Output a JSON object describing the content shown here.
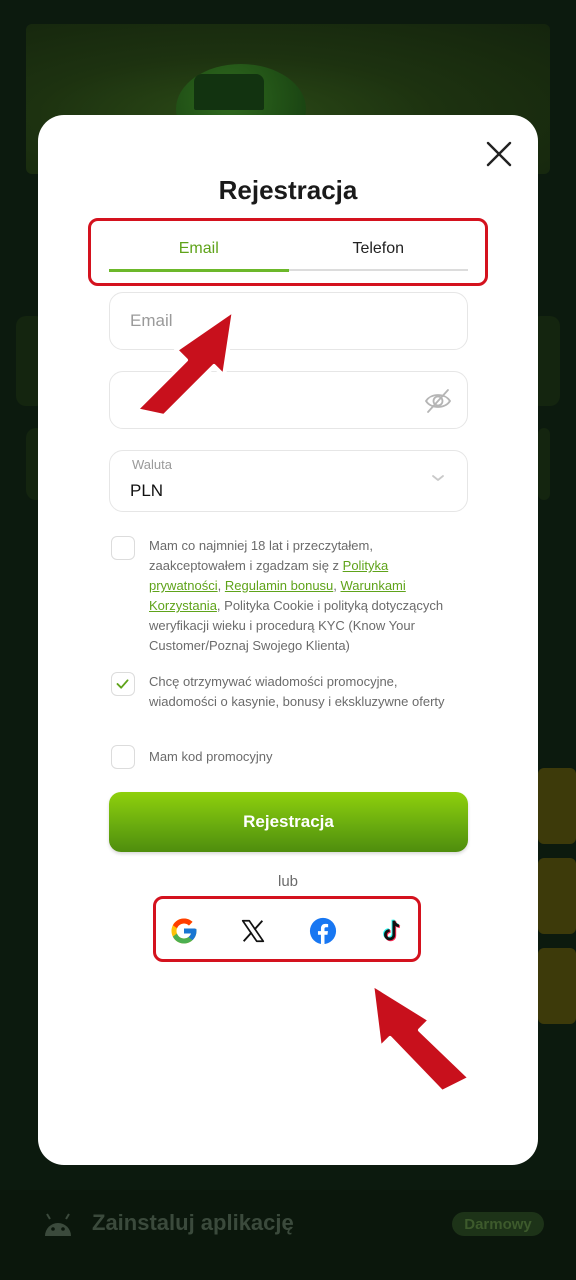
{
  "modal": {
    "title": "Rejestracja",
    "close_icon": "close-icon"
  },
  "tabs": [
    {
      "label": "Email",
      "active": true
    },
    {
      "label": "Telefon",
      "active": false
    }
  ],
  "form": {
    "email_placeholder": "Email",
    "password_placeholder": "",
    "currency_label": "Waluta",
    "currency_value": "PLN"
  },
  "consents": {
    "terms": {
      "checked": false,
      "text_part1": "Mam co najmniej 18 lat i przeczytałem, zaakceptowałem i zgadzam się z ",
      "link1": "Polityka prywatności",
      "sep1": ", ",
      "link2": "Regulamin bonusu",
      "sep2": ", ",
      "link3": "Warunkami Korzystania",
      "text_part2": ", Polityka Cookie i polityką dotyczących weryfikacji wieku i procedurą KYC (Know Your Customer/Poznaj Swojego Klienta)"
    },
    "marketing": {
      "checked": true,
      "text": "Chcę otrzymywać wiadomości promocyjne, wiadomości o kasynie, bonusy i ekskluzywne oferty"
    },
    "promo": {
      "checked": false,
      "text": "Mam kod promocyjny"
    }
  },
  "register_button": "Rejestracja",
  "or_label": "lub",
  "social": [
    "google-icon",
    "x-icon",
    "facebook-icon",
    "tiktok-icon"
  ],
  "footer": {
    "install_text": "Zainstaluj aplikację",
    "badge": "Darmowy"
  },
  "colors": {
    "accent": "#6cb82a",
    "highlight": "#d4121e",
    "backdrop": "#0c1a0e"
  }
}
